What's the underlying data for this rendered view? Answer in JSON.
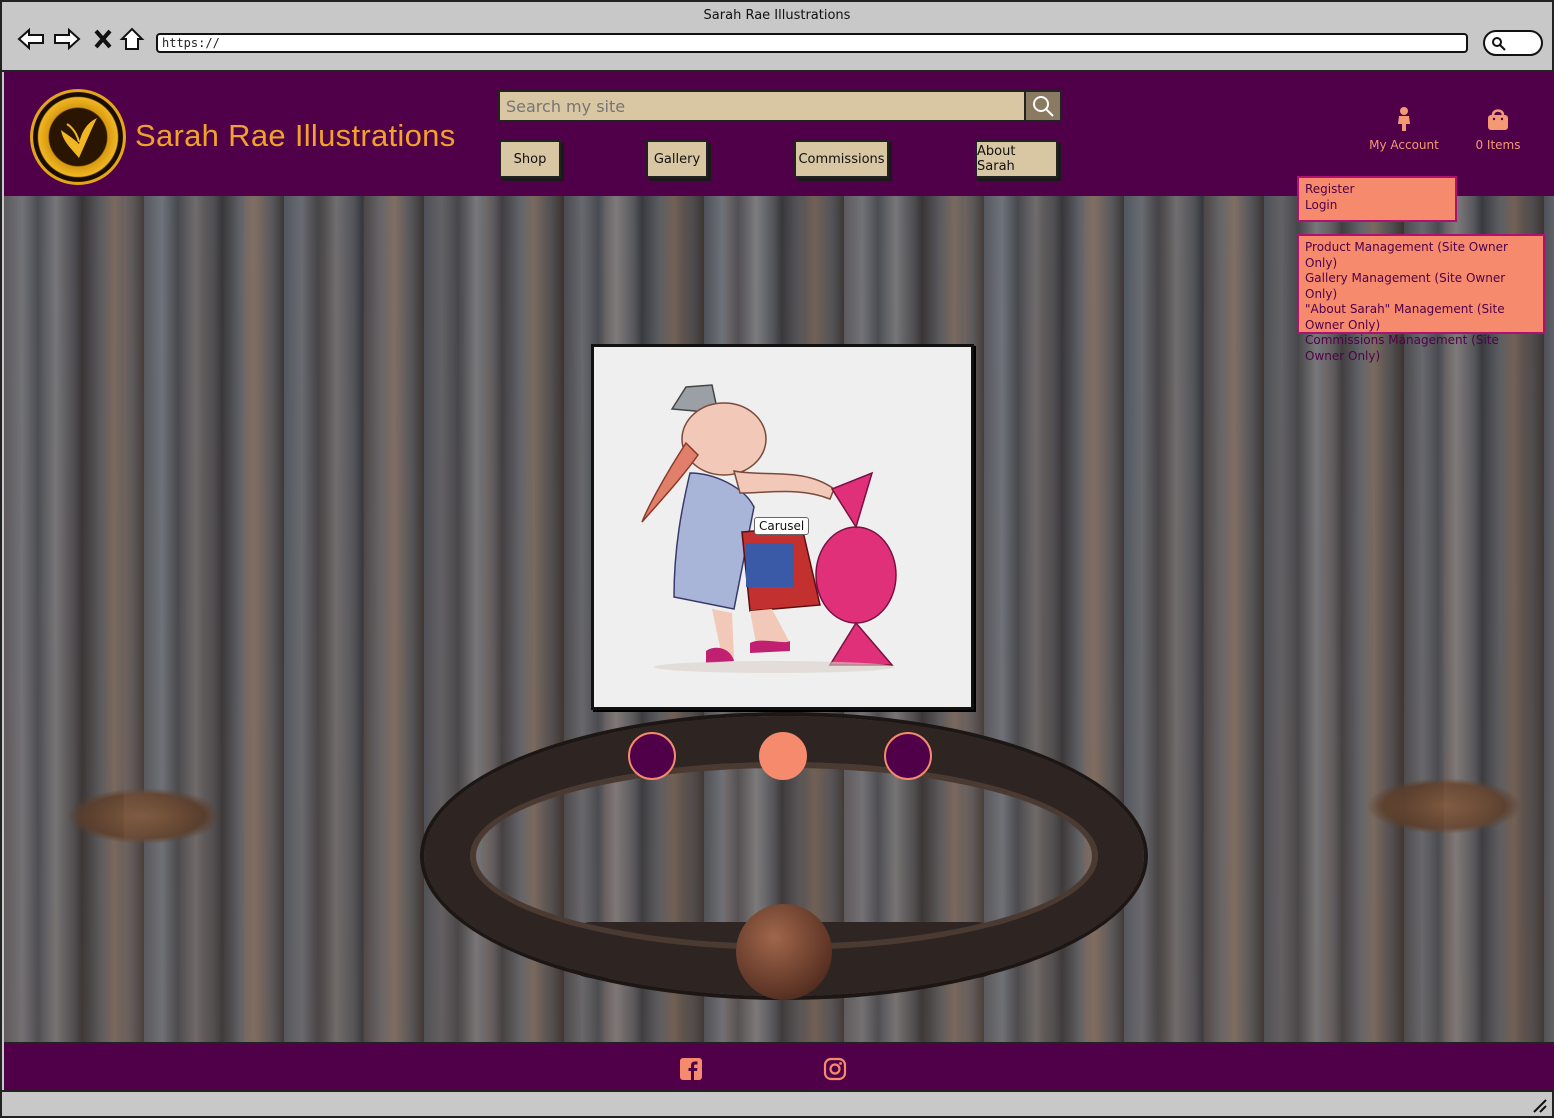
{
  "window": {
    "title": "Sarah Rae Illustrations",
    "url": "https://"
  },
  "header": {
    "brand": "Sarah Rae Illustrations",
    "logo_icon": "circular-badge-logo-icon",
    "search": {
      "placeholder": "Search my site",
      "value": ""
    },
    "nav": [
      "Shop",
      "Gallery",
      "Commissions",
      "About Sarah"
    ],
    "account": {
      "label": "My Account",
      "icon": "person-icon"
    },
    "cart": {
      "label": "0 Items",
      "icon": "shopping-bag-icon"
    }
  },
  "account_menu": {
    "items": [
      "Register",
      "Login"
    ]
  },
  "admin_menu": {
    "items": [
      "Product Management (Site Owner Only)",
      "Gallery Management (Site Owner Only)",
      "\"About Sarah\" Management (Site Owner Only)",
      "Commissions Management (Site Owner Only)"
    ]
  },
  "carousel": {
    "label": "Carusel",
    "active_index": 1,
    "dots": 3
  },
  "footer": {
    "icons": [
      "facebook-icon",
      "instagram-icon"
    ]
  },
  "colors": {
    "primary": "#4f0048",
    "accent": "#f58b6c",
    "brand_text": "#f0a22a",
    "button_bg": "#d9c6a3"
  }
}
